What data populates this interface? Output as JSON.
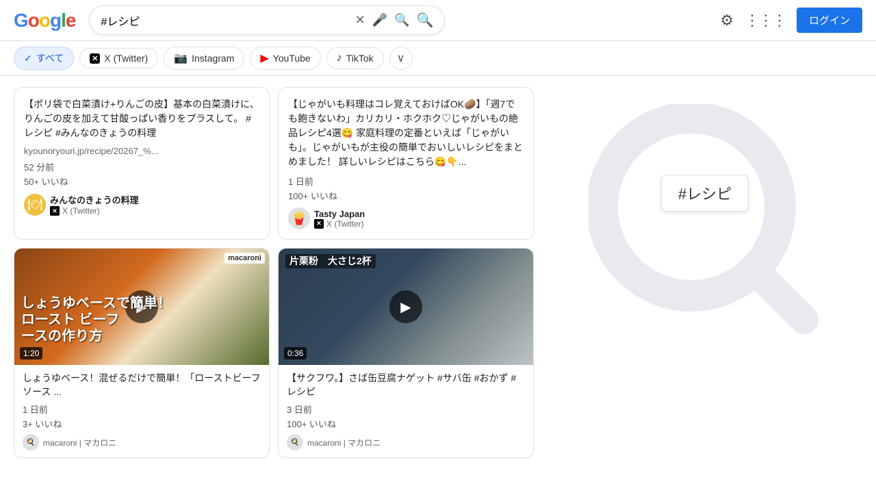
{
  "header": {
    "logo_text": "Google",
    "search_query": "#レシピ",
    "login_label": "ログイン"
  },
  "filters": {
    "tabs": [
      {
        "id": "all",
        "label": "すべて",
        "icon": "✓",
        "active": true
      },
      {
        "id": "twitter",
        "label": "X (Twitter)",
        "icon": "✕",
        "active": false
      },
      {
        "id": "instagram",
        "label": "Instagram",
        "icon": "◎",
        "active": false
      },
      {
        "id": "youtube",
        "label": "YouTube",
        "icon": "▶",
        "active": false
      },
      {
        "id": "tiktok",
        "label": "TikTok",
        "icon": "♪",
        "active": false
      }
    ],
    "more_icon": "∨"
  },
  "tweet_cards": [
    {
      "text": "【ポリ袋で白菜漬け+りんごの皮】基本の白菜漬けに、りんごの皮を加えて甘酸っぱい香りをプラスして。 #レシピ #みんなのきょうの料理",
      "url": "kyounoryouri.jp/recipe/20267_%...",
      "time": "52 分前",
      "likes": "50+ いいね",
      "author_name": "みんなのきょうの料理",
      "platform": "X (Twitter)"
    },
    {
      "text": "【じゃがいも料理はコレ覚えておけばOK🥔】「週7でも飽きないわ」カリカリ・ホクホク♡じゃがいもの絶品レシピ4選😋\n家庭料理の定番といえば「じゃがいも」。じゃがいもが主役の簡単でおいしいレシピをまとめました！\n\n詳しいレシピはこちら😋👇...",
      "url": "",
      "time": "1 日前",
      "likes": "100+ いいね",
      "author_name": "Tasty Japan",
      "platform": "X (Twitter)"
    }
  ],
  "video_cards": [
    {
      "title": "しょうゆベース！混ぜるだけで簡単！「ローストビーフソース ...",
      "overlay_line1": "しょうゆベースで簡単！",
      "overlay_line2": "ロースト ビーフ",
      "overlay_line3": "ースの作り方",
      "duration": "1:20",
      "source": "macaroni",
      "time": "1 日前",
      "likes": "3+ いいね",
      "author": "macaroni | マカロニ",
      "thumb_class": "thumb-1"
    },
    {
      "title": "【サクフワ。】さば缶豆腐ナゲット #サバ缶 #おかず #レシピ",
      "overlay_line1": "片栗粉　大さじ2杯",
      "duration": "0:36",
      "source": "",
      "time": "3 日前",
      "likes": "100+ いいね",
      "author": "macaroni | マカロニ",
      "thumb_class": "thumb-2"
    }
  ],
  "sidebar": {
    "hashtag": "#レシピ"
  }
}
